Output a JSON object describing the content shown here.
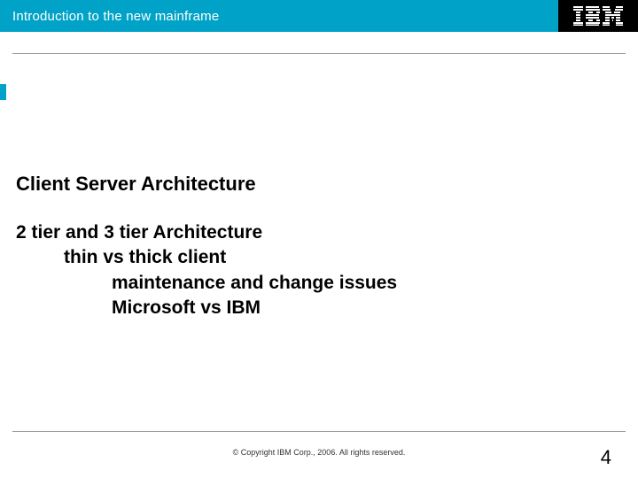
{
  "header": {
    "title": "Introduction to the new mainframe",
    "logo": "IBM"
  },
  "content": {
    "heading": "Client Server Architecture",
    "lines": [
      "2 tier and 3 tier Architecture",
      "thin vs thick client",
      "maintenance and change issues",
      "Microsoft vs IBM"
    ]
  },
  "footer": {
    "copyright": "© Copyright IBM Corp., 2006. All rights reserved.",
    "page": "4"
  }
}
